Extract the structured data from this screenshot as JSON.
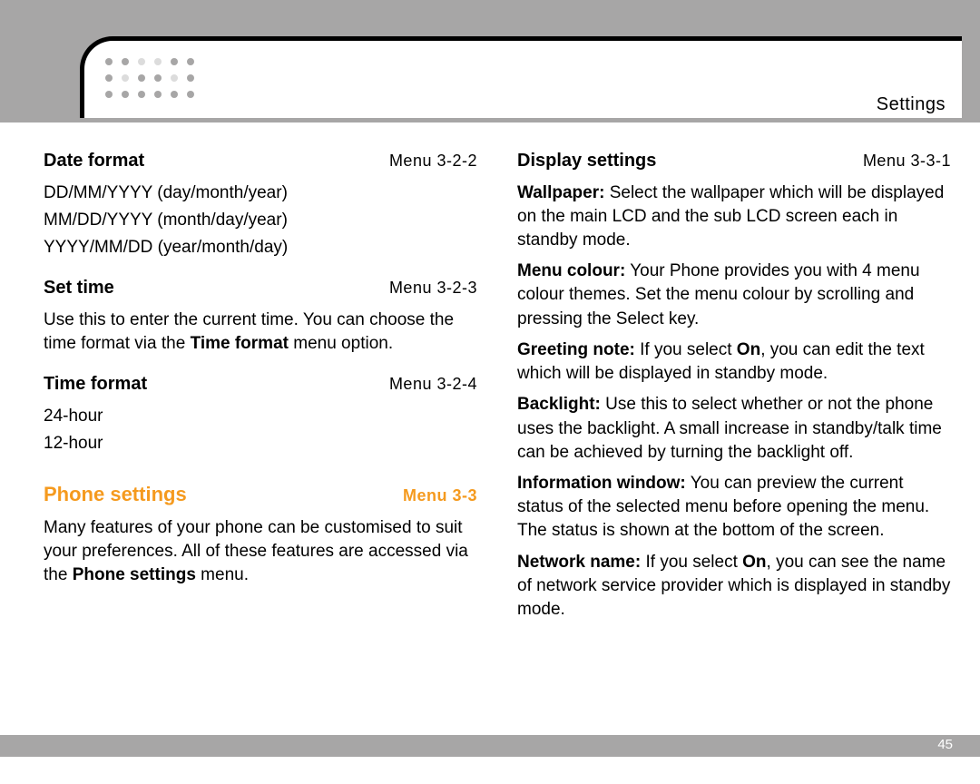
{
  "header": {
    "section": "Settings"
  },
  "left": {
    "date_format": {
      "title": "Date format",
      "menu": "Menu 3-2-2",
      "options": [
        "DD/MM/YYYY (day/month/year)",
        "MM/DD/YYYY (month/day/year)",
        "YYYY/MM/DD (year/month/day)"
      ]
    },
    "set_time": {
      "title": "Set time",
      "menu": "Menu 3-2-3",
      "body_pre": "Use this to enter the current time. You can choose the time format via the ",
      "body_bold": "Time format",
      "body_post": " menu option."
    },
    "time_format": {
      "title": "Time format",
      "menu": "Menu 3-2-4",
      "options": [
        "24-hour",
        "12-hour"
      ]
    },
    "phone_settings": {
      "title": "Phone settings",
      "menu": "Menu 3-3",
      "body_pre": "Many features of your phone can be customised to suit your preferences. All of these features are accessed via the ",
      "body_bold": "Phone settings",
      "body_post": " menu."
    }
  },
  "right": {
    "display_settings": {
      "title": "Display settings",
      "menu": "Menu 3-3-1",
      "items": {
        "wallpaper": {
          "label": "Wallpaper:",
          "text": " Select the wallpaper which will be displayed on the main LCD and the sub LCD screen each in standby mode."
        },
        "menu_colour": {
          "label": "Menu colour:",
          "text": " Your Phone provides you with 4 menu colour themes. Set the menu colour by scrolling and pressing the Select key."
        },
        "greeting": {
          "label": "Greeting note:",
          "pre": " If you select ",
          "on": "On",
          "post": ", you can edit the text which will be displayed in standby mode."
        },
        "backlight": {
          "label": "Backlight:",
          "text": " Use this to select whether or not the phone uses the backlight. A small increase in standby/talk time can be achieved by turning the backlight off."
        },
        "info_window": {
          "label": "Information window:",
          "text": " You can preview the current status of the selected menu before opening the menu. The status is shown at the bottom of the screen."
        },
        "network": {
          "label": "Network name:",
          "pre": " If you select ",
          "on": "On",
          "post": ", you can see the name of  network service provider which is displayed in standby mode."
        }
      }
    }
  },
  "footer": {
    "page": "45"
  }
}
